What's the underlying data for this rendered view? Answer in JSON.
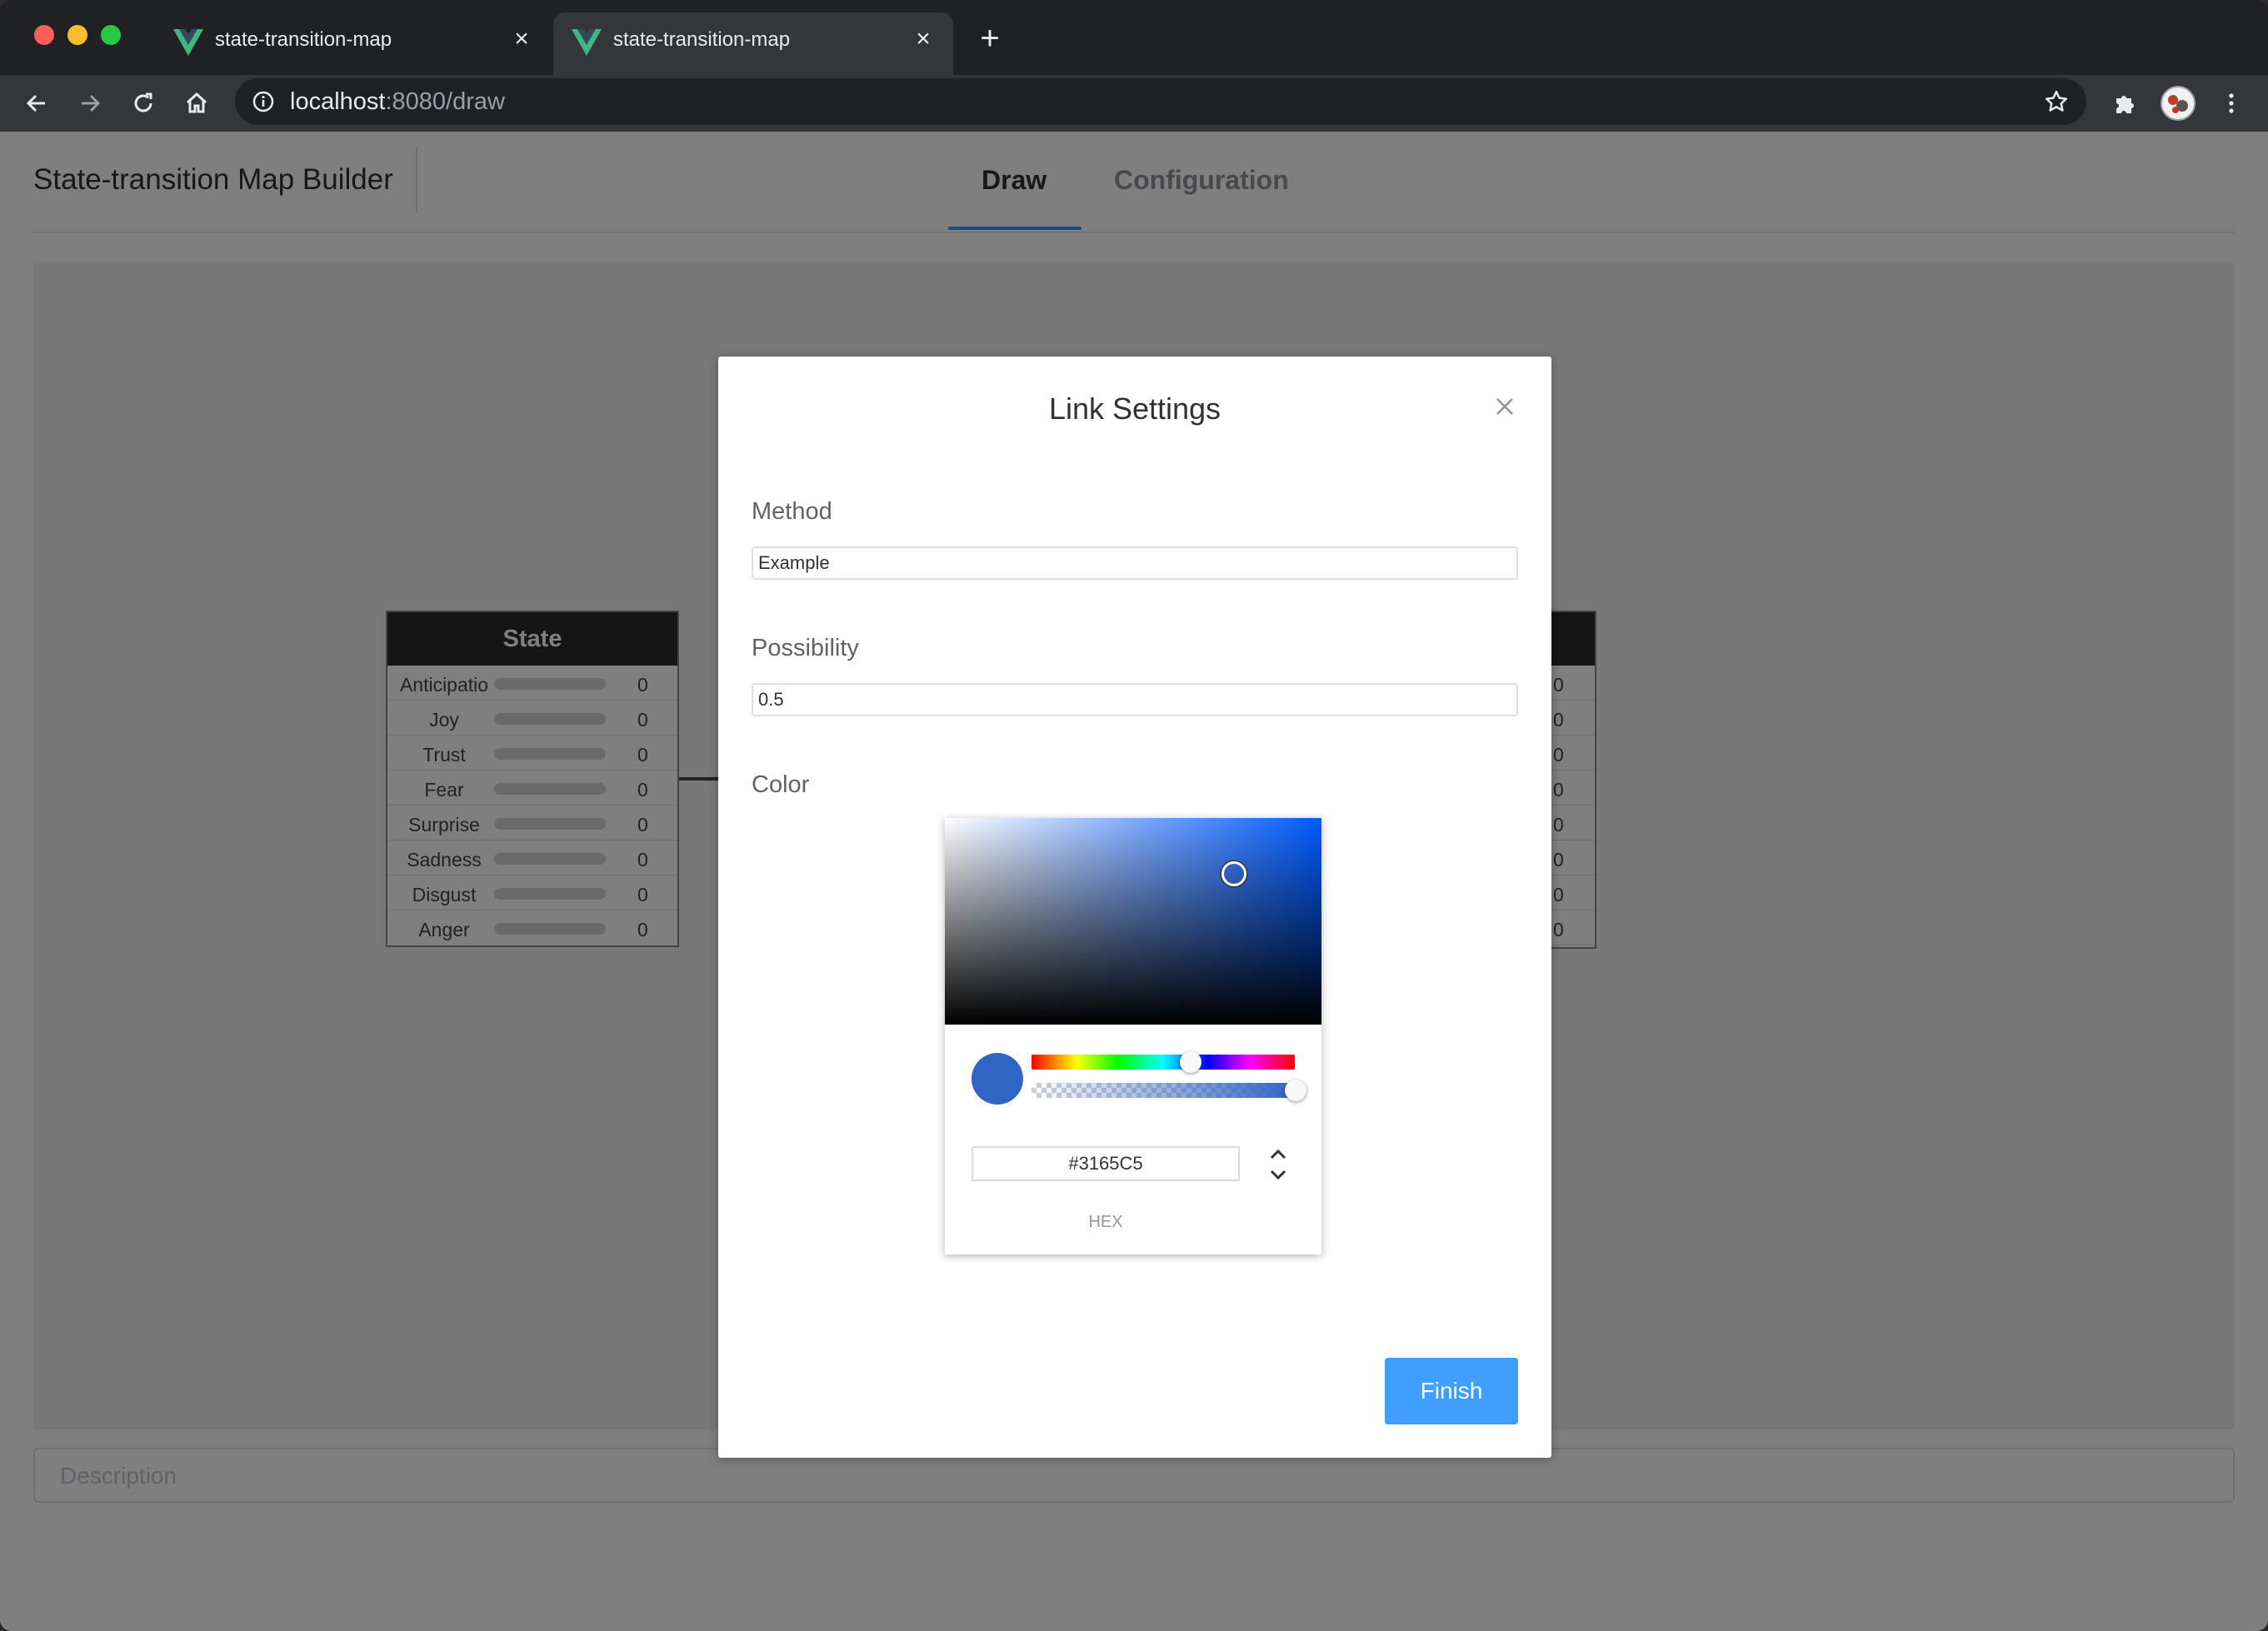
{
  "browser": {
    "tabs": [
      {
        "title": "state-transition-map",
        "active": false
      },
      {
        "title": "state-transition-map",
        "active": true
      }
    ],
    "url_host": "localhost",
    "url_rest": ":8080/draw"
  },
  "app": {
    "title": "State-transition Map Builder",
    "nav": [
      {
        "label": "Draw",
        "active": true
      },
      {
        "label": "Configuration",
        "active": false
      }
    ]
  },
  "canvas": {
    "state_node": {
      "title": "State",
      "rows": [
        {
          "label": "Anticipatio",
          "value": "0"
        },
        {
          "label": "Joy",
          "value": "0"
        },
        {
          "label": "Trust",
          "value": "0"
        },
        {
          "label": "Fear",
          "value": "0"
        },
        {
          "label": "Surprise",
          "value": "0"
        },
        {
          "label": "Sadness",
          "value": "0"
        },
        {
          "label": "Disgust",
          "value": "0"
        },
        {
          "label": "Anger",
          "value": "0"
        }
      ]
    },
    "right_node_values": [
      "0",
      "0",
      "0",
      "0",
      "0",
      "0",
      "0",
      "0"
    ]
  },
  "description": {
    "placeholder": "Description"
  },
  "dialog": {
    "title": "Link Settings",
    "method_label": "Method",
    "method_value": "Example",
    "possibility_label": "Possibility",
    "possibility_value": "0.5",
    "color_label": "Color",
    "color_picker": {
      "hex_value": "#3165C5",
      "format_label": "HEX",
      "color": "#3165C5",
      "alpha": 1.0
    },
    "finish_label": "Finish"
  },
  "colors": {
    "accent": "#409eff",
    "node_header": "#2b2b2b"
  }
}
